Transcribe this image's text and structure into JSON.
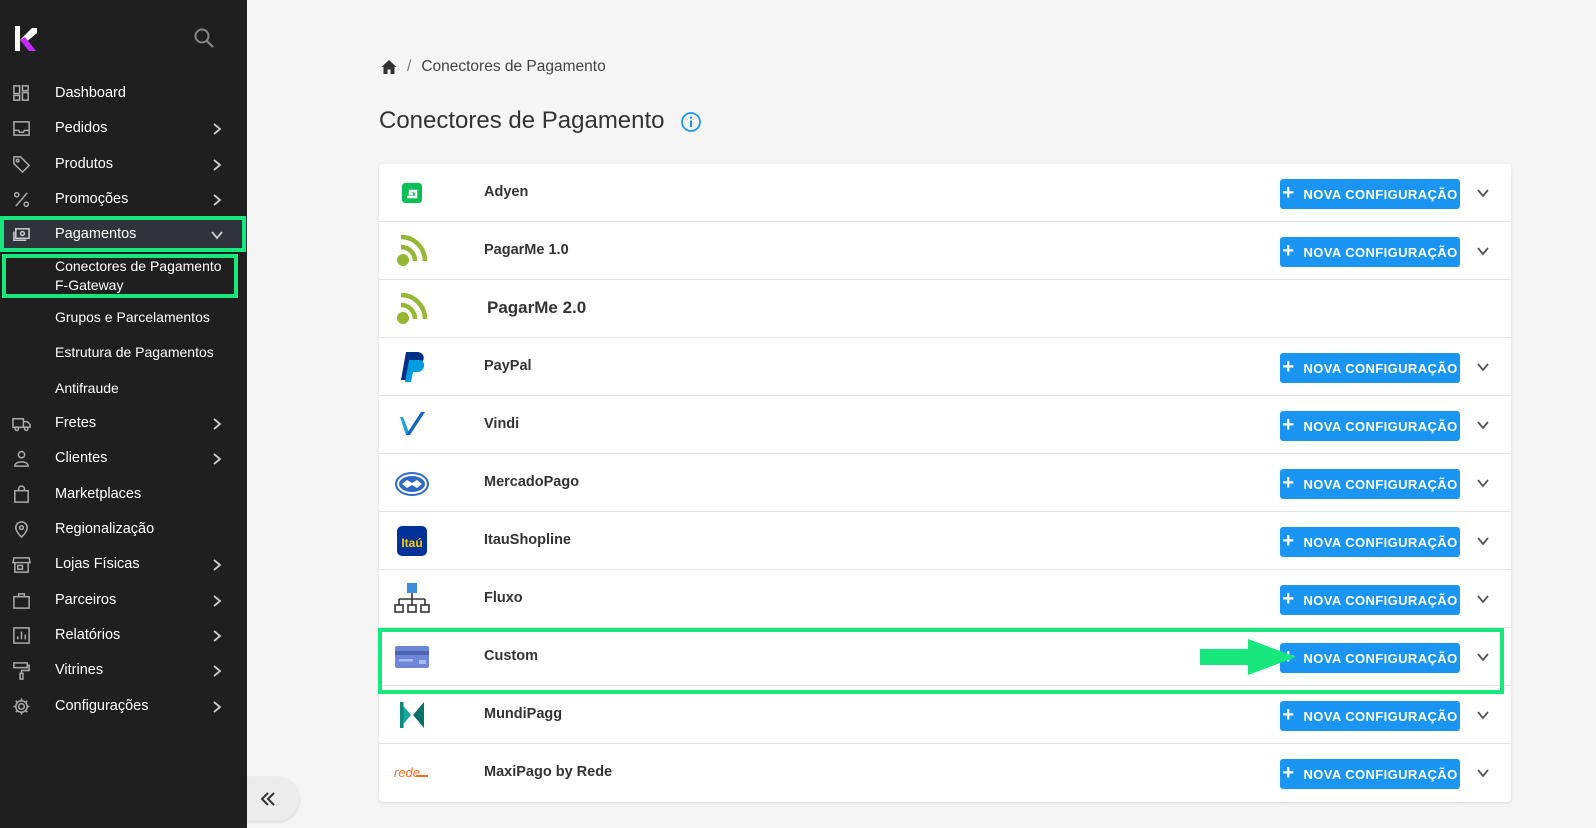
{
  "sidebar": {
    "logo_icon": "kuantic-k-logo",
    "search_icon": "search-icon",
    "items": [
      {
        "label": "Dashboard",
        "icon": "dashboard-icon",
        "expandable": false
      },
      {
        "label": "Pedidos",
        "icon": "inbox-icon",
        "expandable": true
      },
      {
        "label": "Produtos",
        "icon": "tag-icon",
        "expandable": true
      },
      {
        "label": "Promoções",
        "icon": "percent-icon",
        "expandable": true
      },
      {
        "label": "Pagamentos",
        "icon": "payments-icon",
        "expandable": true,
        "expanded": true
      },
      {
        "label": "Fretes",
        "icon": "truck-icon",
        "expandable": true
      },
      {
        "label": "Clientes",
        "icon": "person-icon",
        "expandable": true
      },
      {
        "label": "Marketplaces",
        "icon": "shopping-bag-icon",
        "expandable": false
      },
      {
        "label": "Regionalização",
        "icon": "location-pin-icon",
        "expandable": false
      },
      {
        "label": "Lojas Físicas",
        "icon": "store-icon",
        "expandable": true
      },
      {
        "label": "Parceiros",
        "icon": "briefcase-icon",
        "expandable": true
      },
      {
        "label": "Relatórios",
        "icon": "report-icon",
        "expandable": true
      },
      {
        "label": "Vitrines",
        "icon": "paint-roller-icon",
        "expandable": true
      },
      {
        "label": "Configurações",
        "icon": "gear-icon",
        "expandable": true
      }
    ],
    "sub_items": [
      {
        "label_line1": "Conectores de Pagamento",
        "label_line2": "F-Gateway"
      },
      {
        "label": "Grupos e Parcelamentos"
      },
      {
        "label": "Estrutura de Pagamentos"
      },
      {
        "label": "Antifraude"
      }
    ],
    "collapse_icon": "double-chevron-left-icon"
  },
  "breadcrumb": {
    "home_icon": "home-icon",
    "separator": "/",
    "current": "Conectores de Pagamento"
  },
  "page": {
    "title": "Conectores de Pagamento",
    "info_icon": "info-icon"
  },
  "connectors": [
    {
      "name": "Adyen",
      "logo": "adyen-logo",
      "button_label": "NOVA CONFIGURAÇÃO"
    },
    {
      "name": "PagarMe 1.0",
      "logo": "pagarme-logo",
      "button_label": "NOVA CONFIGURAÇÃO"
    },
    {
      "name": "PagarMe 2.0",
      "logo": "pagarme-logo",
      "button_label": ""
    },
    {
      "name": "PayPal",
      "logo": "paypal-logo",
      "button_label": "NOVA CONFIGURAÇÃO"
    },
    {
      "name": "Vindi",
      "logo": "vindi-logo",
      "button_label": "NOVA CONFIGURAÇÃO"
    },
    {
      "name": "MercadoPago",
      "logo": "mercadopago-logo",
      "button_label": "NOVA CONFIGURAÇÃO"
    },
    {
      "name": "ItauShopline",
      "logo": "itau-logo",
      "logo_text": "Itaú",
      "button_label": "NOVA CONFIGURAÇÃO"
    },
    {
      "name": "Fluxo",
      "logo": "fluxo-logo",
      "button_label": "NOVA CONFIGURAÇÃO"
    },
    {
      "name": "Custom",
      "logo": "credit-card-logo",
      "button_label": "NOVA CONFIGURAÇÃO"
    },
    {
      "name": "MundiPagg",
      "logo": "mundipagg-logo",
      "button_label": "NOVA CONFIGURAÇÃO"
    },
    {
      "name": "MaxiPago by Rede",
      "logo": "rede-logo",
      "logo_text": "rede",
      "button_label": "NOVA CONFIGURAÇÃO"
    }
  ],
  "colors": {
    "sidebar_bg": "#1f1f1f",
    "active_item_bg": "#2e343a",
    "highlight": "#17e77c",
    "primary_button": "#1a96f2"
  }
}
